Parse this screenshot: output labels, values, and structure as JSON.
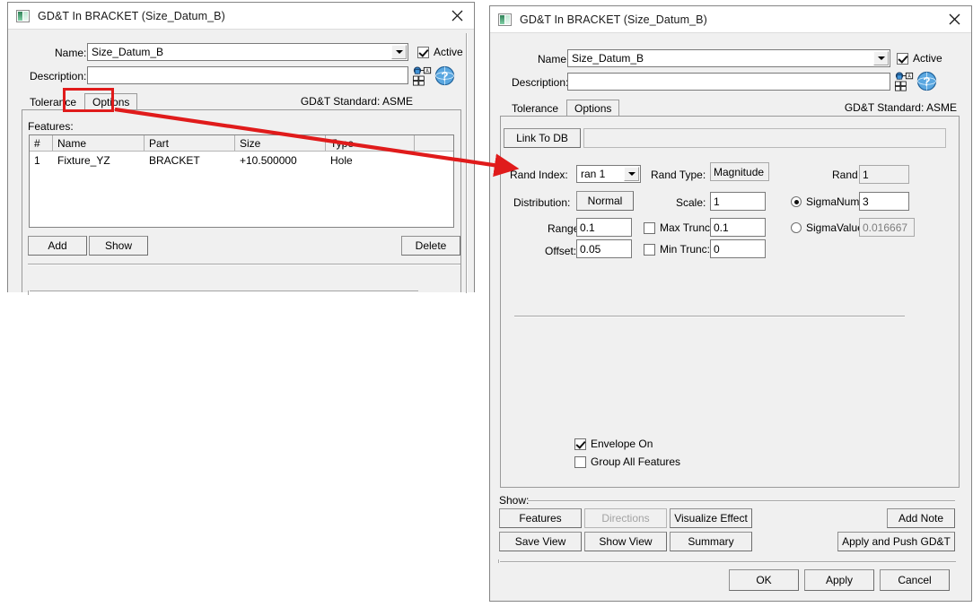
{
  "left_dialog": {
    "title": "GD&T In BRACKET (Size_Datum_B)",
    "close_label": "✕",
    "name_label": "Name:",
    "name_value": "Size_Datum_B",
    "active_label": "Active",
    "description_label": "Description:",
    "description_value": "",
    "gdt_standard": "GD&T Standard: ASME",
    "tabs": [
      {
        "label": "Tolerance",
        "selected": false
      },
      {
        "label": "Options",
        "selected": true
      }
    ],
    "features_label": "Features:",
    "features_table": {
      "columns": [
        "#",
        "Name",
        "Part",
        "Size",
        "Type",
        ""
      ],
      "rows": [
        [
          "1",
          "Fixture_YZ",
          "BRACKET",
          "+10.500000",
          "Hole",
          ""
        ]
      ]
    },
    "buttons": {
      "add": "Add",
      "show": "Show",
      "delete": "Delete"
    }
  },
  "right_dialog": {
    "title": "GD&T In BRACKET (Size_Datum_B)",
    "close_label": "✕",
    "name_label": "Name:",
    "name_value": "Size_Datum_B",
    "active_label": "Active",
    "description_label": "Description:",
    "description_value": "",
    "gdt_standard": "GD&T Standard: ASME",
    "tabs": [
      {
        "label": "Tolerance",
        "selected": false
      },
      {
        "label": "Options",
        "selected": true
      }
    ],
    "options": {
      "link_to_db_label": "Link To DB",
      "link_to_db_value": "",
      "rand_index_label": "Rand Index:",
      "rand_index_value": "ran 1",
      "rand_type_label": "Rand Type:",
      "rand_type_value": "Magnitude",
      "rand_no_label": "Rand No:",
      "rand_no_value": "1",
      "distribution_label": "Distribution:",
      "distribution_value": "Normal",
      "scale_label": "Scale:",
      "scale_value": "1",
      "sigma_num_label": "SigmaNum:",
      "sigma_num_value": "3",
      "sigma_num_selected": true,
      "range_label": "Range:",
      "range_value": "0.1",
      "max_trunc_label": "Max Trunc:",
      "max_trunc_value": "0.1",
      "max_trunc_checked": false,
      "sigma_value_label": "SigmaValue:",
      "sigma_value_value": "0.016667",
      "sigma_value_selected": false,
      "offset_label": "Offset:",
      "offset_value": "0.05",
      "min_trunc_label": "Min Trunc:",
      "min_trunc_value": "0",
      "min_trunc_checked": false,
      "envelope_on_label": "Envelope On",
      "envelope_on_checked": true,
      "group_all_features_label": "Group All Features",
      "group_all_features_checked": false
    },
    "show_group_label": "Show:",
    "show_buttons": {
      "features": "Features",
      "directions": "Directions",
      "directions_disabled": true,
      "visualize_effect": "Visualize Effect",
      "add_note": "Add Note",
      "save_view": "Save View",
      "show_view": "Show View",
      "summary": "Summary",
      "apply_and_push": "Apply and Push GD&T"
    },
    "dialog_buttons": {
      "ok": "OK",
      "apply": "Apply",
      "cancel": "Cancel"
    }
  },
  "annotation": {
    "highlight_target": "Options tab",
    "color": "#e01b1b"
  }
}
